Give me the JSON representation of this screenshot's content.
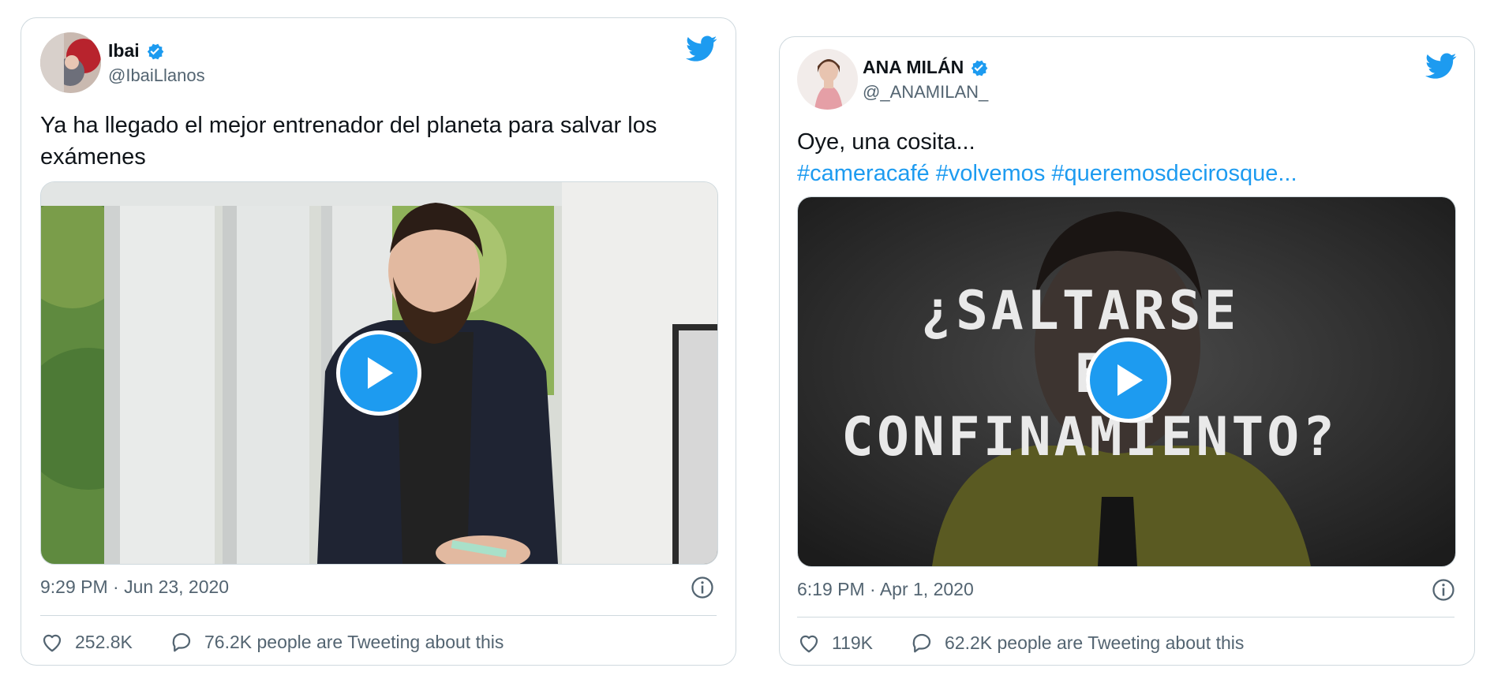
{
  "tweets": [
    {
      "author": {
        "name": "Ibai",
        "handle": "@IbaiLlanos",
        "verified": true
      },
      "text": "Ya ha llegado el mejor entrenador del planeta para salvar los exámenes",
      "timestamp": "9:29 PM · Jun 23, 2020",
      "likes": "252.8K",
      "tweeting": "76.2K people are Tweeting about this"
    },
    {
      "author": {
        "name": "ANA MILÁN",
        "handle": "@_ANAMILAN_",
        "verified": true
      },
      "text": "Oye, una cosita...",
      "hashtags": "#cameracafé #volvemos #queremosdecirosque...",
      "video_overlay": {
        "line1": "¿SALTARSE",
        "line2": "E",
        "line3": "CONFINAMIENTO?"
      },
      "timestamp": "6:19 PM · Apr 1, 2020",
      "likes": "119K",
      "tweeting": "62.2K people are Tweeting about this"
    }
  ],
  "colors": {
    "accent": "#1d9bf0",
    "muted": "#536471",
    "border": "#cfd9de"
  },
  "icons": [
    "verified-badge-icon",
    "twitter-bird-icon",
    "play-icon",
    "info-icon",
    "heart-icon",
    "reply-bubble-icon"
  ]
}
